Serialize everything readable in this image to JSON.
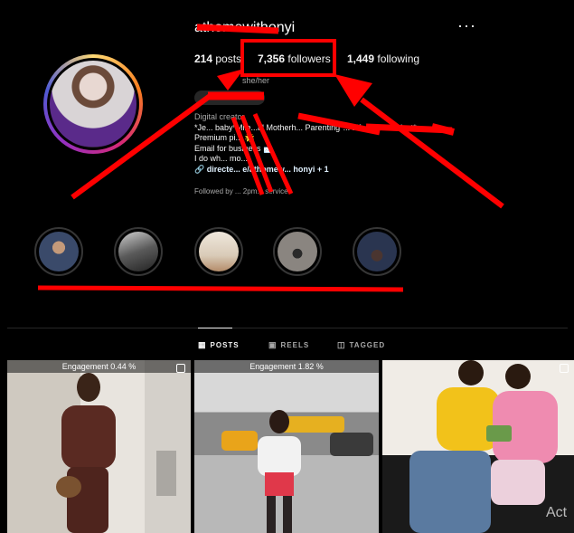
{
  "profile": {
    "username": "athomewithonyi",
    "more_icon": "ellipsis-icon",
    "stats": {
      "posts_count": "214",
      "posts_label": "posts",
      "followers_count": "7,356",
      "followers_label": "followers",
      "following_count": "1,449",
      "following_label": "following"
    },
    "pronoun": "she/her",
    "bio": {
      "category": "Digital creator",
      "line1": "*Je... baby*Mile...al Motherh... Parenting*... Lifestyle...derlust*",
      "line2": "Premium pi... 🌟",
      "line3": "Email for business 📩",
      "line4": "I do wh... mo...",
      "link": "directe... e/athomew... honyi + 1"
    },
    "followed_by": "Followed by ... 2pm... service"
  },
  "highlights": [
    {
      "label": "",
      "color": "#3a4a6a"
    },
    {
      "label": "",
      "color": "#5a5a5a"
    },
    {
      "label": "",
      "color": "#d9cbb8"
    },
    {
      "label": "",
      "color": "#8a8580"
    },
    {
      "label": "",
      "color": "#2a3550"
    }
  ],
  "tabs": [
    {
      "label": "POSTS",
      "icon": "grid-icon",
      "active": true
    },
    {
      "label": "REELS",
      "icon": "reels-icon",
      "active": false
    },
    {
      "label": "TAGGED",
      "icon": "tag-icon",
      "active": false
    }
  ],
  "posts": [
    {
      "engagement": "Engagement 0.44 %",
      "has_multi_icon": true
    },
    {
      "engagement": "Engagement 1.82 %",
      "has_multi_icon": false
    },
    {
      "engagement": "",
      "has_multi_icon": true
    }
  ],
  "watermark": "Act",
  "colors": {
    "annotation_red": "#ff0000",
    "background": "#000000",
    "muted_text": "#a8a8a8"
  }
}
